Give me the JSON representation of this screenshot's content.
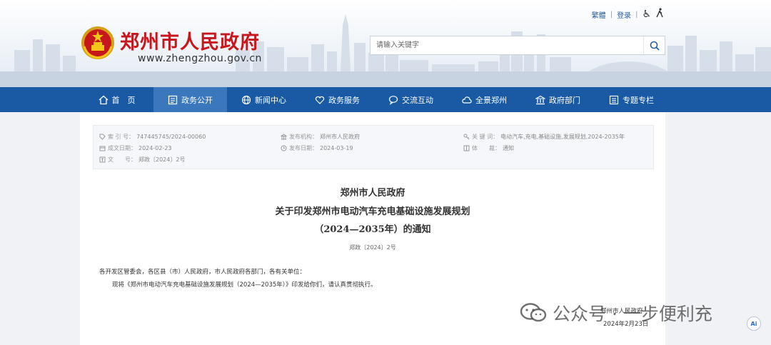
{
  "header": {
    "top_links": {
      "simplified": "繁體",
      "login": "登录"
    },
    "site_name": "郑州市人民政府",
    "site_url": "www.zhengzhou.gov.cn",
    "search_placeholder": "请输入关键字"
  },
  "nav": {
    "items": [
      {
        "label": "首　页",
        "icon": "home-icon"
      },
      {
        "label": "政务公开",
        "icon": "document-icon",
        "active": true
      },
      {
        "label": "新闻中心",
        "icon": "globe-icon"
      },
      {
        "label": "政务服务",
        "icon": "heart-icon"
      },
      {
        "label": "交流互动",
        "icon": "chat-icon"
      },
      {
        "label": "全景郑州",
        "icon": "cloud-icon"
      },
      {
        "label": "政府部门",
        "icon": "building-icon"
      },
      {
        "label": "专题专栏",
        "icon": "list-icon"
      }
    ],
    "accent": "#1a5aa5",
    "active_color": "#3b77bd"
  },
  "meta": {
    "index_label": "索 引 号：",
    "index_value": "747445745/2024-00060",
    "publisher_label": "发布机构：",
    "publisher_value": "郑州市人民政府",
    "keywords_label": "关 键 词：",
    "keywords_value": "电动汽车,充电,基础设施,发展规划,2024-2035年",
    "created_label": "成文日期：",
    "created_value": "2024-02-23",
    "published_label": "发布日期：",
    "published_value": "2024-03-19",
    "genre_label": "体　　裁：",
    "genre_value": "通知",
    "docno_label": "文　　号：",
    "docno_value": "郑政〔2024〕2号"
  },
  "document": {
    "title_line1": "郑州市人民政府",
    "title_line2": "关于印发郑州市电动汽车充电基础设施发展规划",
    "title_line3": "（2024—2035年）的通知",
    "doc_no": "郑政〔2024〕2号",
    "recipients": "各开发区管委会，各区县（市）人民政府，市人民政府各部门，各有关单位：",
    "body": "现将《郑州市电动汽车充电基础设施发展规划（2024—2035年）》印发给你们，请认真贯彻执行。",
    "signature": "郑州市人民政府",
    "date": "2024年2月23日"
  },
  "watermark": {
    "text": "公众号 · 一步便利充",
    "ai_badge": "Ai"
  }
}
